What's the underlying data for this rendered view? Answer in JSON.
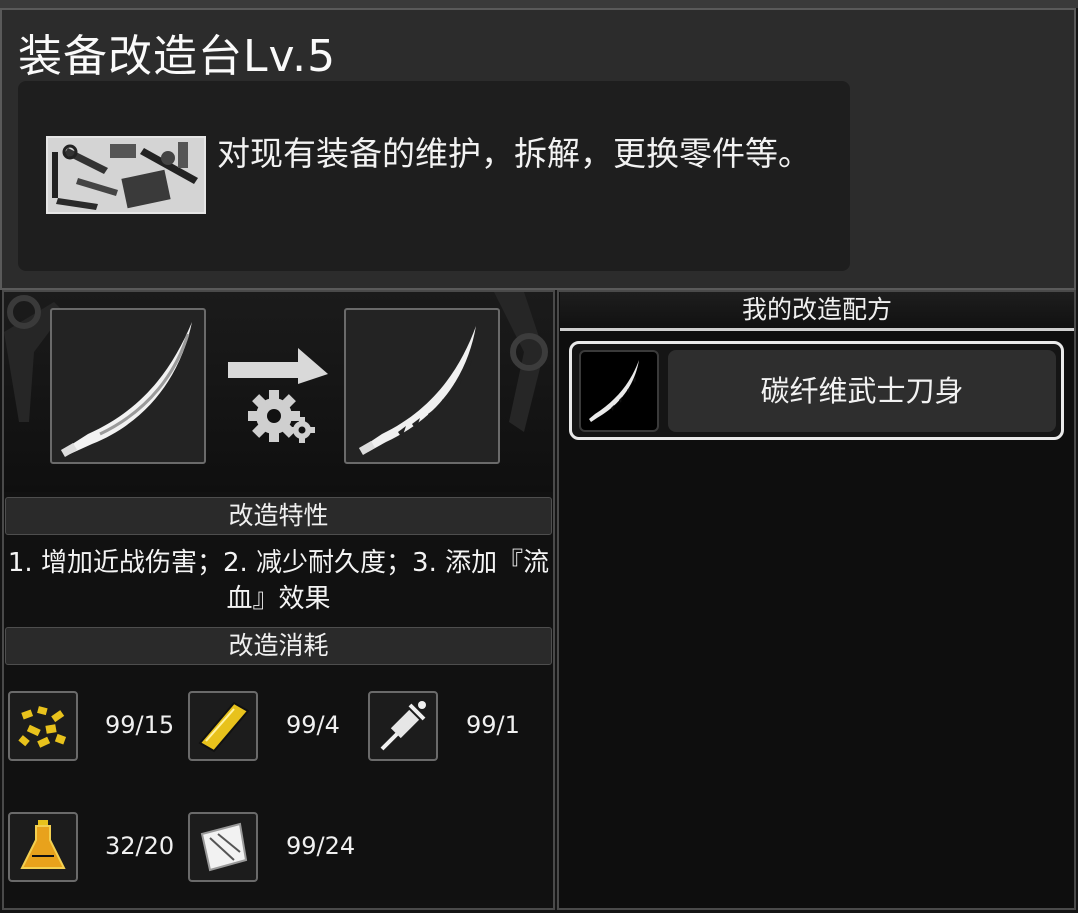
{
  "header": {
    "title": "装备改造台Lv.5",
    "description": "对现有装备的维护，拆解，更换零件等。"
  },
  "modify": {
    "source_item_icon": "katana-blade-icon",
    "result_item_icon": "serrated-katana-blade-icon",
    "process_icon": "gears-icon",
    "traits_label": "改造特性",
    "traits_text": "1. 增加近战伤害；2. 减少耐久度；3. 添加『流血』效果",
    "cost_label": "改造消耗",
    "materials": [
      {
        "icon": "scrap-metal-icon",
        "count": "99/15"
      },
      {
        "icon": "metal-plate-icon",
        "count": "99/4"
      },
      {
        "icon": "syringe-tool-icon",
        "count": "99/1"
      },
      {
        "icon": "potion-flask-icon",
        "count": "32/20"
      },
      {
        "icon": "cloth-sheet-icon",
        "count": "99/24"
      }
    ]
  },
  "recipes": {
    "header": "我的改造配方",
    "items": [
      {
        "name": "碳纤维武士刀身",
        "icon": "katana-blade-icon"
      }
    ]
  },
  "colors": {
    "gold": "#e8c21c",
    "panel": "#2c2c2c",
    "highlight": "#e9e9e9"
  }
}
